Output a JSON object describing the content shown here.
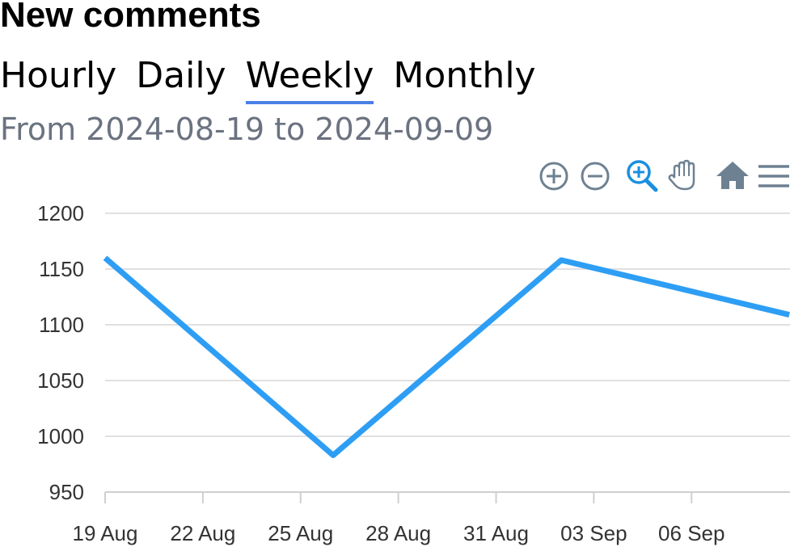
{
  "header": {
    "title": "New comments"
  },
  "tabs": [
    {
      "label": "Hourly",
      "active": false
    },
    {
      "label": "Daily",
      "active": false
    },
    {
      "label": "Weekly",
      "active": true
    },
    {
      "label": "Monthly",
      "active": false
    }
  ],
  "date_range": "From 2024-08-19 to 2024-09-09",
  "toolbar": {
    "icons": [
      "zoom-in-icon",
      "zoom-out-icon",
      "selection-zoom-icon",
      "pan-hand-icon",
      "reset-home-icon",
      "menu-icon"
    ],
    "active_icon": "selection-zoom-icon",
    "active_color": "#1a8fe0",
    "icon_color": "#6e8192"
  },
  "chart_data": {
    "type": "line",
    "title": "",
    "xlabel": "",
    "ylabel": "",
    "x": [
      "2024-08-19",
      "2024-08-26",
      "2024-09-02",
      "2024-09-09"
    ],
    "series": [
      {
        "values": [
          1160,
          983,
          1158,
          1109
        ]
      }
    ],
    "ylim": [
      950,
      1200
    ],
    "y_ticks": [
      1200,
      1150,
      1100,
      1050,
      1000,
      950
    ],
    "x_ticks": [
      "19 Aug",
      "22 Aug",
      "25 Aug",
      "28 Aug",
      "31 Aug",
      "03 Sep",
      "06 Sep"
    ],
    "x_tick_dates": [
      "2024-08-19",
      "2024-08-22",
      "2024-08-25",
      "2024-08-28",
      "2024-08-31",
      "2024-09-03",
      "2024-09-06"
    ],
    "grid": true,
    "line_color": "#2e9ef4"
  }
}
